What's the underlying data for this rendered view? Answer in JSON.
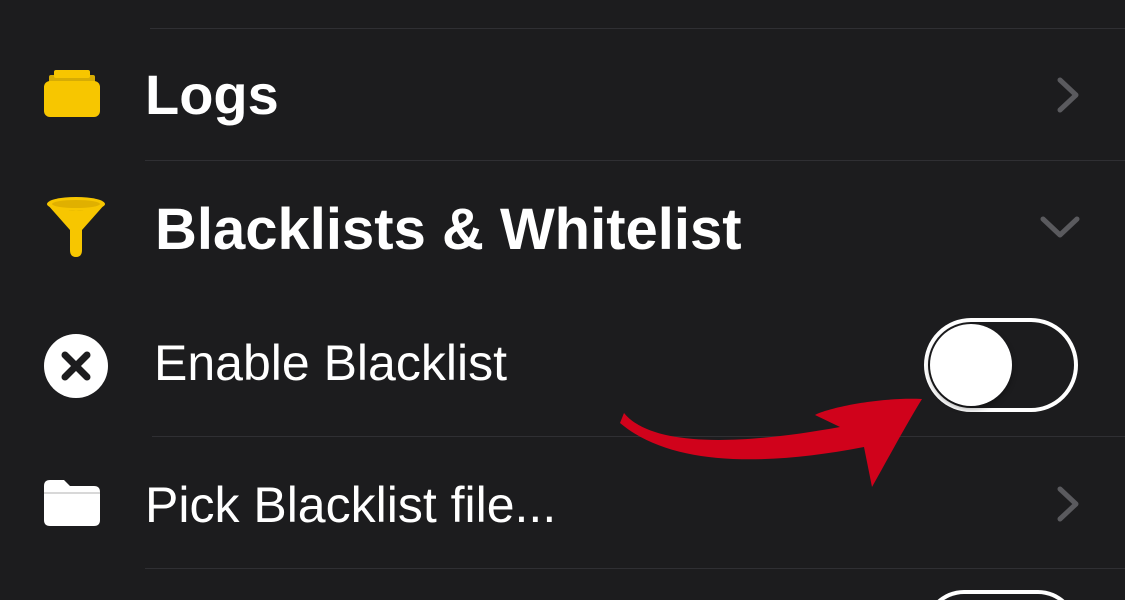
{
  "colors": {
    "background": "#1c1c1e",
    "accent_yellow": "#f7c600",
    "arrow_red": "#d0021b",
    "separator": "#2f2f33",
    "chevron": "#5a5a5e"
  },
  "rows": {
    "logs": {
      "label": "Logs",
      "icon": "folder-icon",
      "accessory": "chevron-right-icon"
    },
    "lists": {
      "label": "Blacklists & Whitelist",
      "icon": "funnel-icon",
      "accessory": "chevron-down-icon"
    },
    "enable_blacklist": {
      "label": "Enable Blacklist",
      "icon": "x-circle-icon",
      "toggle_on": false
    },
    "pick_file": {
      "label": "Pick Blacklist file...",
      "icon": "folder-icon",
      "accessory": "chevron-right-icon"
    }
  },
  "annotation": {
    "icon": "red-arrow-icon"
  }
}
